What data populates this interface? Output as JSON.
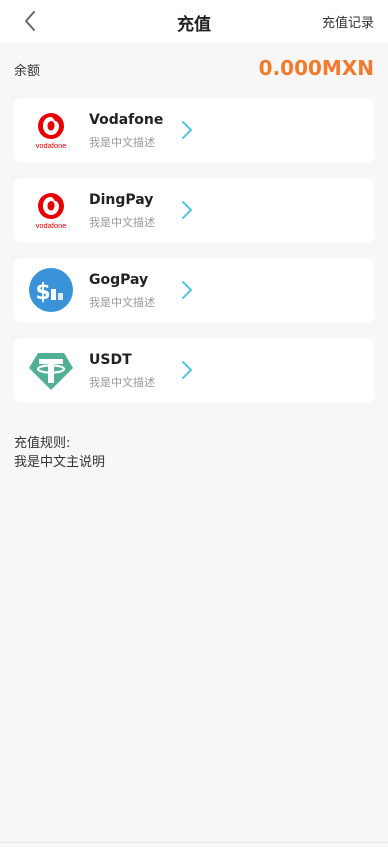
{
  "header": {
    "title": "充值",
    "record_label": "充值记录"
  },
  "balance": {
    "label": "余额",
    "value": "0.000MXN"
  },
  "methods": [
    {
      "name": "Vodafone",
      "description": "我是中文描述",
      "logo": "vodafone-logo",
      "logo_text": "vodafone"
    },
    {
      "name": "DingPay",
      "description": "我是中文描述",
      "logo": "vodafone-logo",
      "logo_text": "vodafone"
    },
    {
      "name": "GogPay",
      "description": "我是中文描述",
      "logo": "dollar-chart-logo"
    },
    {
      "name": "USDT",
      "description": "我是中文描述",
      "logo": "tether-logo"
    }
  ],
  "rules": {
    "title": "充值规则:",
    "text": "我是中文主说明"
  },
  "colors": {
    "accent": "#f07b2c",
    "chevron": "#5ec6d8",
    "vodafone_red": "#e60000",
    "gogpay_blue": "#3a93d8",
    "tether_green": "#50af95"
  }
}
